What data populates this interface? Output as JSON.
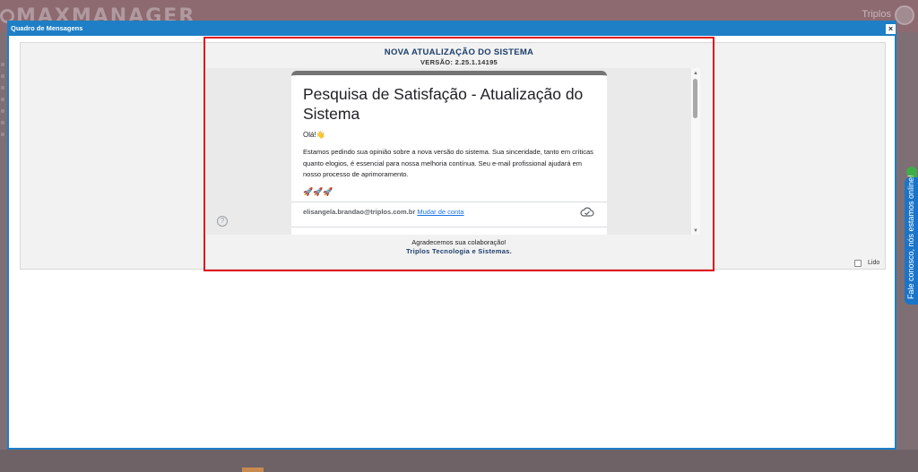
{
  "background": {
    "logo": "MAXMANAGER",
    "user": "Triplos"
  },
  "modal": {
    "title": "Quadro de Mensagens",
    "close_label": "×"
  },
  "message": {
    "title": "NOVA ATUALIZAÇÃO DO SISTEMA",
    "version": "VERSÃO: 2.25.1.14195",
    "thanks": "Agradecemos sua colaboração!",
    "company": "Triplos Tecnologia e Sistemas."
  },
  "form": {
    "heading": "Pesquisa de Satisfação - Atualização do Sistema",
    "greeting": "Olá!👋",
    "description": "Estamos pedindo sua opinião sobre a nova versão do sistema. Sua sinceridade, tanto em críticas quanto elogios, é essencial para nossa melhoria contínua. Seu e-mail profissional ajudará em nosso processo de aprimoramento.",
    "emoji_line": "🚀🚀🚀",
    "email": "elisangela.brandao@triplos.com.br",
    "switch_account": "Mudar de conta"
  },
  "read_checkbox": {
    "label": "Lido",
    "checked": false
  },
  "feedback_tab": {
    "label": "Fale conosco, nós estamos online!"
  },
  "colors": {
    "titlebar": "#1e7fc6",
    "highlight": "#e0141b",
    "title_text": "#1c3e6b",
    "link": "#1a73e8",
    "feedback": "#1a75c9"
  }
}
